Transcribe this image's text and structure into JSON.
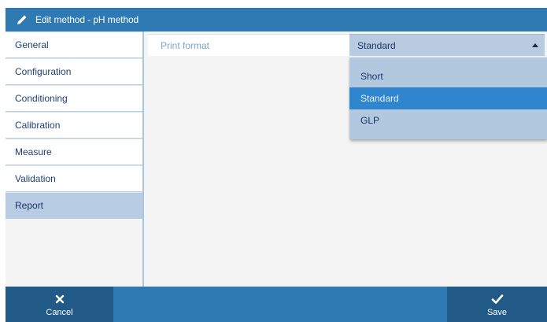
{
  "window": {
    "title": "Edit method - pH method",
    "icon": "pencil-icon"
  },
  "sidebar": {
    "items": [
      {
        "label": "General",
        "active": false
      },
      {
        "label": "Configuration",
        "active": false
      },
      {
        "label": "Conditioning",
        "active": false
      },
      {
        "label": "Calibration",
        "active": false
      },
      {
        "label": "Measure",
        "active": false
      },
      {
        "label": "Validation",
        "active": false
      },
      {
        "label": "Report",
        "active": true
      }
    ]
  },
  "form": {
    "print_format": {
      "label": "Print format",
      "value": "Standard",
      "options": [
        "Short",
        "Standard",
        "GLP"
      ],
      "highlighted": "Standard"
    }
  },
  "footer": {
    "cancel_label": "Cancel",
    "cancel_icon": "close-icon",
    "save_label": "Save",
    "save_icon": "checkmark-icon"
  },
  "colors": {
    "header": "#2f7ab2",
    "button_dark": "#215a86",
    "selected_option": "#2f86cf",
    "active_item": "#b8cde3"
  }
}
